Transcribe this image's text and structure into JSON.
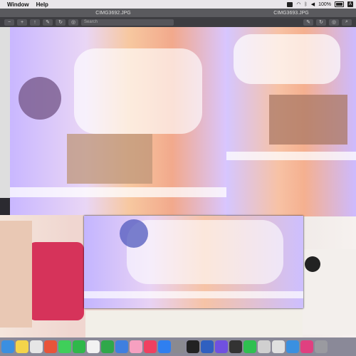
{
  "menubar": {
    "menus": [
      "Window",
      "Help"
    ],
    "battery": "100%"
  },
  "windows": {
    "left": {
      "title": "CIMG3692.JPG",
      "search_placeholder": "Search"
    },
    "right": {
      "title": "CIMG3693.JPG"
    }
  },
  "dock": {
    "icons": [
      "finder-icon",
      "notes-icon",
      "photos-icon",
      "chrome-icon",
      "messages-icon",
      "facetime-icon",
      "calendar-icon",
      "numbers-icon",
      "keynote-icon",
      "photos2-icon",
      "music-icon",
      "app-store-icon",
      "system-prefs-icon",
      "ndi-icon",
      "capture-icon",
      "shortcuts-icon",
      "unity-icon",
      "line-icon",
      "script-icon",
      "preview-icon",
      "finder2-icon",
      "music2-icon",
      "trash-icon"
    ],
    "colors": [
      "#3b8fe0",
      "#f4d44a",
      "#e6e6e6",
      "#e8543a",
      "#3fcf5a",
      "#2fb84a",
      "#f2f2f2",
      "#2fa84a",
      "#3f7fe0",
      "#f6a0c0",
      "#f04060",
      "#2f7ff0",
      "#8a8a90",
      "#222222",
      "#3060c0",
      "#7050e0",
      "#333333",
      "#2fc050",
      "#d0d0d0",
      "#e0e0e0",
      "#3a90e0",
      "#e04080",
      "#9a9aa0"
    ]
  }
}
